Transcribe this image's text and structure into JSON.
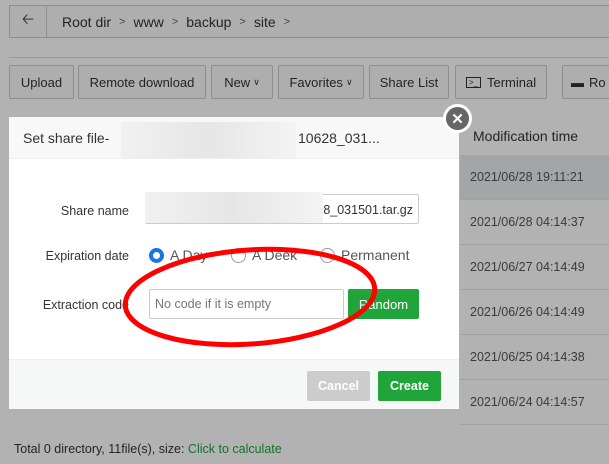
{
  "breadcrumb": {
    "back_icon": "arrow-left-icon",
    "items": [
      "Root dir",
      "www",
      "backup",
      "site"
    ]
  },
  "toolbar": {
    "upload": "Upload",
    "remote_download": "Remote download",
    "new": "New",
    "favorites": "Favorites",
    "share_list": "Share List",
    "terminal": "Terminal",
    "root": "Ro"
  },
  "table": {
    "header": "Modification time",
    "rows": [
      "2021/06/28 19:11:21",
      "2021/06/28 04:14:37",
      "2021/06/27 04:14:49",
      "2021/06/26 04:14:49",
      "2021/06/25 04:14:38",
      "2021/06/24 04:14:57"
    ]
  },
  "footer": {
    "summary": "Total 0 directory, 11file(s), size:",
    "calculate_link": "Click to calculate"
  },
  "modal": {
    "title_prefix": "Set share file-",
    "title_suffix": "10628_031...",
    "share_name_label": "Share name",
    "share_name_value": "28_031501.tar.gz",
    "expiration_label": "Expiration date",
    "expiration_options": [
      "A Day",
      "A Deek",
      "Permanent"
    ],
    "expiration_selected": "A Day",
    "extraction_label": "Extraction code",
    "extraction_placeholder": "No code if it is empty",
    "extraction_value": "",
    "random": "Random",
    "cancel": "Cancel",
    "create": "Create"
  },
  "colors": {
    "accent_green": "#20a53a",
    "radio_blue": "#1a73e8",
    "annotation_red": "#ff0000"
  }
}
